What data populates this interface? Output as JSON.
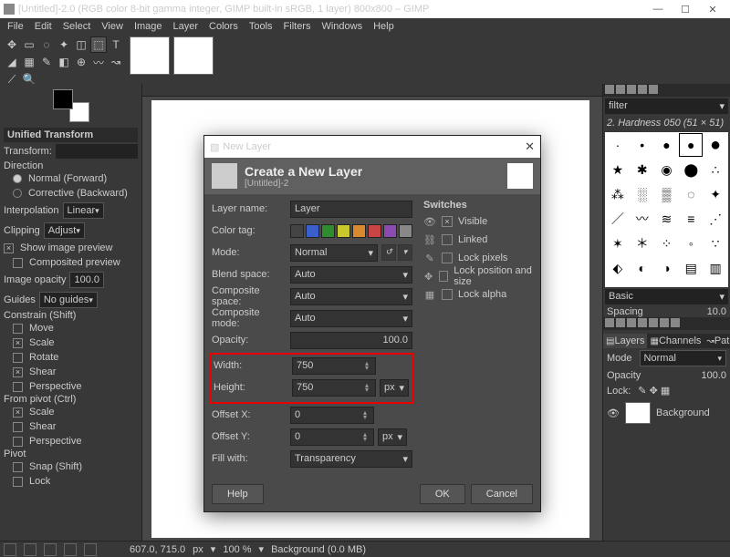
{
  "window": {
    "title": "[Untitled]-2.0 (RGB color 8-bit gamma integer, GIMP built-in sRGB, 1 layer) 800x800 – GIMP"
  },
  "menu": [
    "File",
    "Edit",
    "Select",
    "View",
    "Image",
    "Layer",
    "Colors",
    "Tools",
    "Filters",
    "Windows",
    "Help"
  ],
  "left": {
    "section": "Unified Transform",
    "transform": "Transform:",
    "direction": "Direction",
    "dir_normal": "Normal (Forward)",
    "dir_corrective": "Corrective (Backward)",
    "interpolation": "Interpolation",
    "interp_v": "Linear",
    "clipping": "Clipping",
    "clip_v": "Adjust",
    "show_preview": "Show image preview",
    "composited": "Composited preview",
    "opacity": "Image opacity",
    "opacity_v": "100.0",
    "guides": "Guides",
    "guides_v": "No guides",
    "constrain": "Constrain (Shift)",
    "c_move": "Move",
    "c_scale": "Scale",
    "c_rotate": "Rotate",
    "c_shear": "Shear",
    "c_persp": "Perspective",
    "pivot": "From pivot  (Ctrl)",
    "p_scale": "Scale",
    "p_shear": "Shear",
    "p_persp": "Perspective",
    "pv": "Pivot",
    "pv_snap": "Snap (Shift)",
    "pv_lock": "Lock"
  },
  "dialog": {
    "title": "New Layer",
    "header": "Create a New Layer",
    "subtitle": "[Untitled]-2",
    "layer_name_l": "Layer name:",
    "layer_name_v": "Layer",
    "color_tag_l": "Color tag:",
    "mode_l": "Mode:",
    "mode_v": "Normal",
    "blend_l": "Blend space:",
    "blend_v": "Auto",
    "comp_space_l": "Composite space:",
    "comp_space_v": "Auto",
    "comp_mode_l": "Composite mode:",
    "comp_mode_v": "Auto",
    "opacity_l": "Opacity:",
    "opacity_v": "100.0",
    "width_l": "Width:",
    "width_v": "750",
    "height_l": "Height:",
    "height_v": "750",
    "unit": "px",
    "offx_l": "Offset X:",
    "offx_v": "0",
    "offy_l": "Offset Y:",
    "offy_v": "0",
    "fill_l": "Fill with:",
    "fill_v": "Transparency",
    "switches": "Switches",
    "sw_visible": "Visible",
    "sw_linked": "Linked",
    "sw_lockpx": "Lock pixels",
    "sw_lockpos": "Lock position and size",
    "sw_lockalpha": "Lock alpha",
    "help": "Help",
    "ok": "OK",
    "cancel": "Cancel",
    "colors": [
      "#444",
      "#3a5fcd",
      "#2e8b2e",
      "#c9c92e",
      "#d98a2e",
      "#c94444",
      "#8a4ab0",
      "#888"
    ]
  },
  "right": {
    "filter": "filter",
    "brush": "2. Hardness 050 (51 × 51)",
    "basic": "Basic",
    "spacing": "Spacing",
    "spacing_v": "10.0",
    "tabs": {
      "layers": "Layers",
      "channels": "Channels",
      "paths": "Paths"
    },
    "mode": "Mode",
    "mode_v": "Normal",
    "opacity": "Opacity",
    "opacity_v": "100.0",
    "lock": "Lock:",
    "layer0": "Background"
  },
  "status": {
    "coords": "607.0, 715.0",
    "unit": "px",
    "zoom": "100 %",
    "layer": "Background (0.0 MB)"
  }
}
